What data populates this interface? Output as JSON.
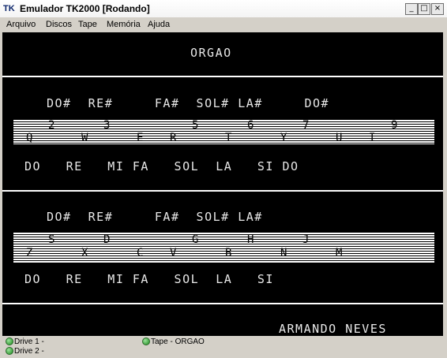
{
  "window": {
    "icon_text": "TK",
    "title": "Emulador TK2000 [Rodando]",
    "buttons": {
      "minimize": "_",
      "maximize": "□",
      "close": "×"
    }
  },
  "menu": {
    "items": [
      "Arquivo",
      "Discos",
      "Tape",
      "Memória",
      "Ajuda"
    ]
  },
  "screen": {
    "title": "ORGAO",
    "panel1": {
      "sharps": "DO#  RE#     FA#  SOL# LA#     DO#",
      "top_keys": [
        "2",
        "3",
        "5",
        "6",
        "7",
        "9"
      ],
      "bottom_keys": [
        "Q",
        "W",
        "E",
        "R",
        "T",
        "Y",
        "U",
        "I"
      ],
      "notes": "DO   RE   MI FA   SOL  LA   SI DO"
    },
    "panel2": {
      "sharps": "DO#  RE#     FA#  SOL# LA#",
      "top_keys": [
        "S",
        "D",
        "G",
        "H",
        "J"
      ],
      "bottom_keys": [
        "Z",
        "X",
        "C",
        "V",
        "B",
        "N",
        "M"
      ],
      "notes": "DO   RE   MI FA   SOL  LA   SI"
    },
    "author": "ARMANDO NEVES"
  },
  "status": {
    "drive1": "Drive 1 -",
    "drive2": "Drive 2 -",
    "tape": "Tape - ORGAO",
    "led_color": "#2aa02a"
  }
}
